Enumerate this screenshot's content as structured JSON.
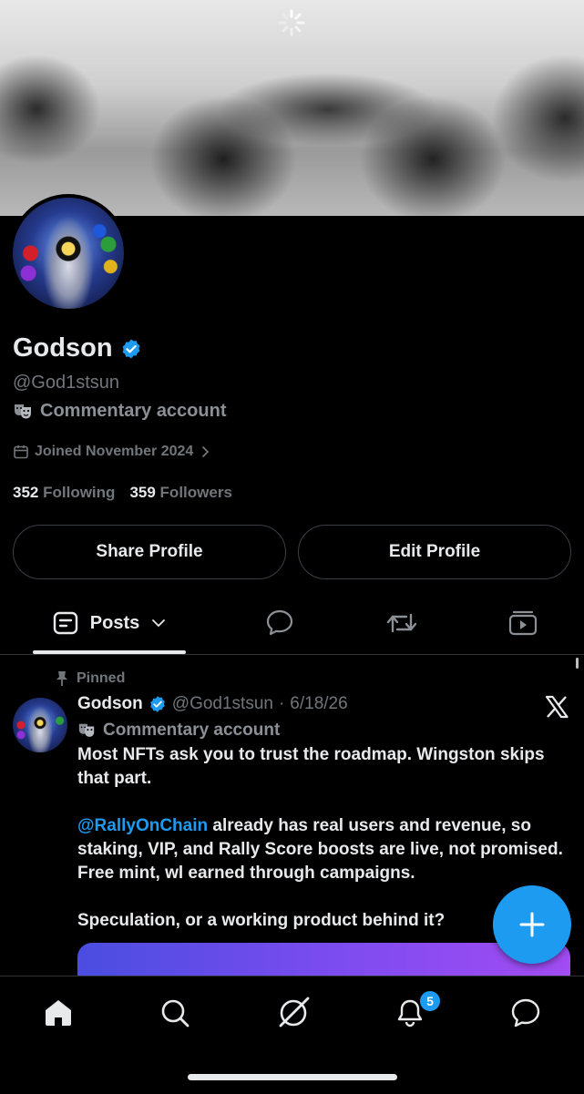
{
  "profile": {
    "name": "Godson",
    "handle": "@God1stsun",
    "label_icon": "theater-masks-icon",
    "label": "Commentary account",
    "joined": "Joined November 2024",
    "following_count": "352",
    "following_label": "Following",
    "followers_count": "359",
    "followers_label": "Followers",
    "share_button": "Share Profile",
    "edit_button": "Edit Profile"
  },
  "tabs": {
    "posts_label": "Posts",
    "items": [
      "posts",
      "replies",
      "reposts",
      "media"
    ]
  },
  "post": {
    "pinned_label": "Pinned",
    "author_name": "Godson",
    "author_handle": "@God1stsun",
    "separator": "·",
    "date": "6/18/26",
    "author_label": "Commentary account",
    "line1": "Most NFTs ask you to trust the roadmap. Wingston skips that part.",
    "mention": "@RallyOnChain",
    "line2": " already has real users and revenue, so staking, VIP, and Rally Score boosts are live, not promised. Free mint, wl earned through campaigns.",
    "line3": "Speculation, or a working product behind it?"
  },
  "bottom_nav": {
    "items": [
      "home-icon",
      "search-icon",
      "grok-icon",
      "notifications-icon",
      "messages-icon"
    ],
    "notification_badge": "5"
  },
  "colors": {
    "background": "#000000",
    "accent": "#1d9bf0",
    "text": "#e7e9ea",
    "muted": "#71767b"
  }
}
